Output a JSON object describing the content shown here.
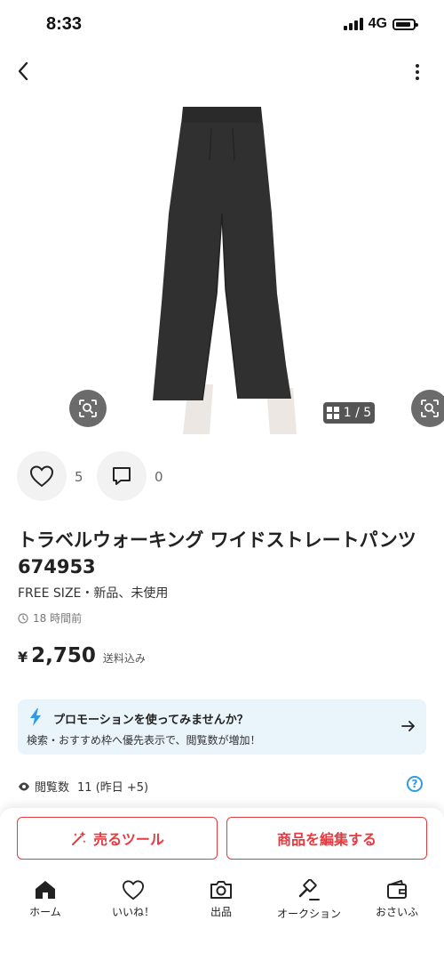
{
  "status_bar": {
    "time": "8:33",
    "network": "4G"
  },
  "product": {
    "image_counter": "1 / 5",
    "likes": "5",
    "comments": "0",
    "title": "トラベルウォーキング ワイドストレートパンツ　674953",
    "condition": "FREE SIZE・新品、未使用",
    "posted": "18 時間前",
    "price_symbol": "¥",
    "price": "2,750",
    "price_note": "送料込み"
  },
  "promo": {
    "title": "プロモーションを使ってみませんか？",
    "description": "検索・おすすめ枠へ優先表示で、閲覧数が増加！"
  },
  "stats": {
    "views_label": "閲覧数",
    "views_value": "11 (昨日 +5)"
  },
  "actions": {
    "sell_tool": "売るツール",
    "edit_item": "商品を編集する"
  },
  "tabs": [
    {
      "label": "ホーム",
      "icon": "home-icon"
    },
    {
      "label": "いいね！",
      "icon": "heart-icon"
    },
    {
      "label": "出品",
      "icon": "camera-icon"
    },
    {
      "label": "オークション",
      "icon": "gavel-icon"
    },
    {
      "label": "おさいふ",
      "icon": "wallet-icon"
    }
  ],
  "colors": {
    "accent_red": "#e53a40",
    "promo_bg": "#eaf4fb",
    "promo_blue": "#2f9be0"
  }
}
